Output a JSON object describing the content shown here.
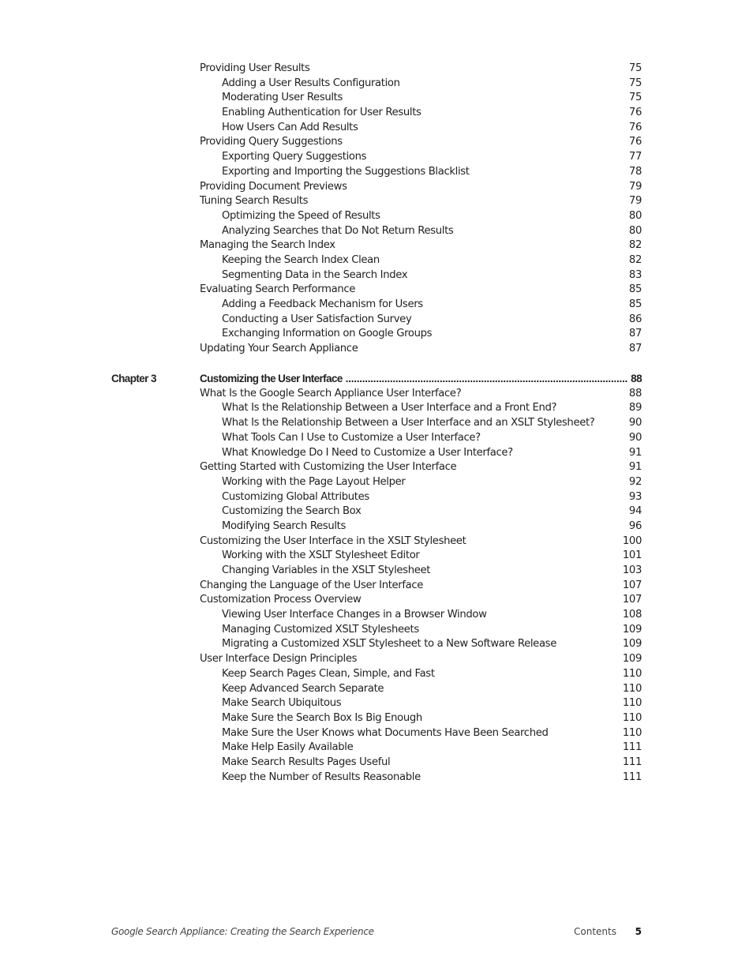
{
  "entries_before": [
    {
      "level": 1,
      "title": "Providing User Results",
      "page": "75"
    },
    {
      "level": 2,
      "title": "Adding a User Results Configuration",
      "page": "75"
    },
    {
      "level": 2,
      "title": "Moderating User Results",
      "page": "75"
    },
    {
      "level": 2,
      "title": "Enabling Authentication for User Results",
      "page": "76"
    },
    {
      "level": 2,
      "title": "How Users Can Add Results",
      "page": "76"
    },
    {
      "level": 1,
      "title": "Providing Query Suggestions",
      "page": "76"
    },
    {
      "level": 2,
      "title": "Exporting Query Suggestions",
      "page": "77"
    },
    {
      "level": 2,
      "title": "Exporting and Importing the Suggestions Blacklist",
      "page": "78"
    },
    {
      "level": 1,
      "title": "Providing Document Previews",
      "page": "79"
    },
    {
      "level": 1,
      "title": "Tuning Search Results",
      "page": "79"
    },
    {
      "level": 2,
      "title": "Optimizing the Speed of Results",
      "page": "80"
    },
    {
      "level": 2,
      "title": "Analyzing Searches that Do Not Return Results",
      "page": "80"
    },
    {
      "level": 1,
      "title": "Managing the Search Index",
      "page": "82"
    },
    {
      "level": 2,
      "title": "Keeping the Search Index Clean",
      "page": "82"
    },
    {
      "level": 2,
      "title": "Segmenting Data in the Search Index",
      "page": "83"
    },
    {
      "level": 1,
      "title": "Evaluating Search Performance",
      "page": "85"
    },
    {
      "level": 2,
      "title": "Adding a Feedback Mechanism for Users",
      "page": "85"
    },
    {
      "level": 2,
      "title": "Conducting a User Satisfaction Survey",
      "page": "86"
    },
    {
      "level": 2,
      "title": "Exchanging Information on Google Groups",
      "page": "87"
    },
    {
      "level": 1,
      "title": "Updating Your Search Appliance",
      "page": "87"
    }
  ],
  "chapter": {
    "label": "Chapter 3",
    "title": "Customizing the User Interface",
    "page": "88"
  },
  "entries_after": [
    {
      "level": 1,
      "title": "What Is the Google Search Appliance User Interface?",
      "page": "88"
    },
    {
      "level": 2,
      "title": "What Is the Relationship Between a User Interface and a Front End?",
      "page": "89"
    },
    {
      "level": 2,
      "title": "What Is the Relationship Between a User Interface and an XSLT Stylesheet?",
      "page": "90"
    },
    {
      "level": 2,
      "title": "What Tools Can I Use to Customize a User Interface?",
      "page": "90"
    },
    {
      "level": 2,
      "title": "What Knowledge Do I Need to Customize a User Interface?",
      "page": "91"
    },
    {
      "level": 1,
      "title": "Getting Started with Customizing the User Interface",
      "page": "91"
    },
    {
      "level": 2,
      "title": "Working with the Page Layout Helper",
      "page": "92"
    },
    {
      "level": 2,
      "title": "Customizing Global Attributes",
      "page": "93"
    },
    {
      "level": 2,
      "title": "Customizing the Search Box",
      "page": "94"
    },
    {
      "level": 2,
      "title": "Modifying Search Results",
      "page": "96"
    },
    {
      "level": 1,
      "title": "Customizing the User Interface in the XSLT Stylesheet",
      "page": "100"
    },
    {
      "level": 2,
      "title": "Working with the XSLT Stylesheet Editor",
      "page": "101"
    },
    {
      "level": 2,
      "title": "Changing Variables in the XSLT Stylesheet",
      "page": "103"
    },
    {
      "level": 1,
      "title": "Changing the Language of the User Interface",
      "page": "107"
    },
    {
      "level": 1,
      "title": "Customization Process Overview",
      "page": "107"
    },
    {
      "level": 2,
      "title": "Viewing User Interface Changes in a Browser Window",
      "page": "108"
    },
    {
      "level": 2,
      "title": "Managing Customized XSLT Stylesheets",
      "page": "109"
    },
    {
      "level": 2,
      "title": "Migrating a Customized XSLT Stylesheet to a New Software Release",
      "page": "109"
    },
    {
      "level": 1,
      "title": "User Interface Design Principles",
      "page": "109"
    },
    {
      "level": 2,
      "title": "Keep Search Pages Clean, Simple, and Fast",
      "page": "110"
    },
    {
      "level": 2,
      "title": "Keep Advanced Search Separate",
      "page": "110"
    },
    {
      "level": 2,
      "title": "Make Search Ubiquitous",
      "page": "110"
    },
    {
      "level": 2,
      "title": "Make Sure the Search Box Is Big Enough",
      "page": "110"
    },
    {
      "level": 2,
      "title": "Make Sure the User Knows what Documents Have Been Searched",
      "page": "110"
    },
    {
      "level": 2,
      "title": "Make Help Easily Available",
      "page": "111"
    },
    {
      "level": 2,
      "title": "Make Search Results Pages Useful",
      "page": "111"
    },
    {
      "level": 2,
      "title": "Keep the Number of Results Reasonable",
      "page": "111"
    }
  ],
  "footer": {
    "book_title": "Google Search Appliance: Creating the Search Experience",
    "section": "Contents",
    "page_number": "5"
  }
}
